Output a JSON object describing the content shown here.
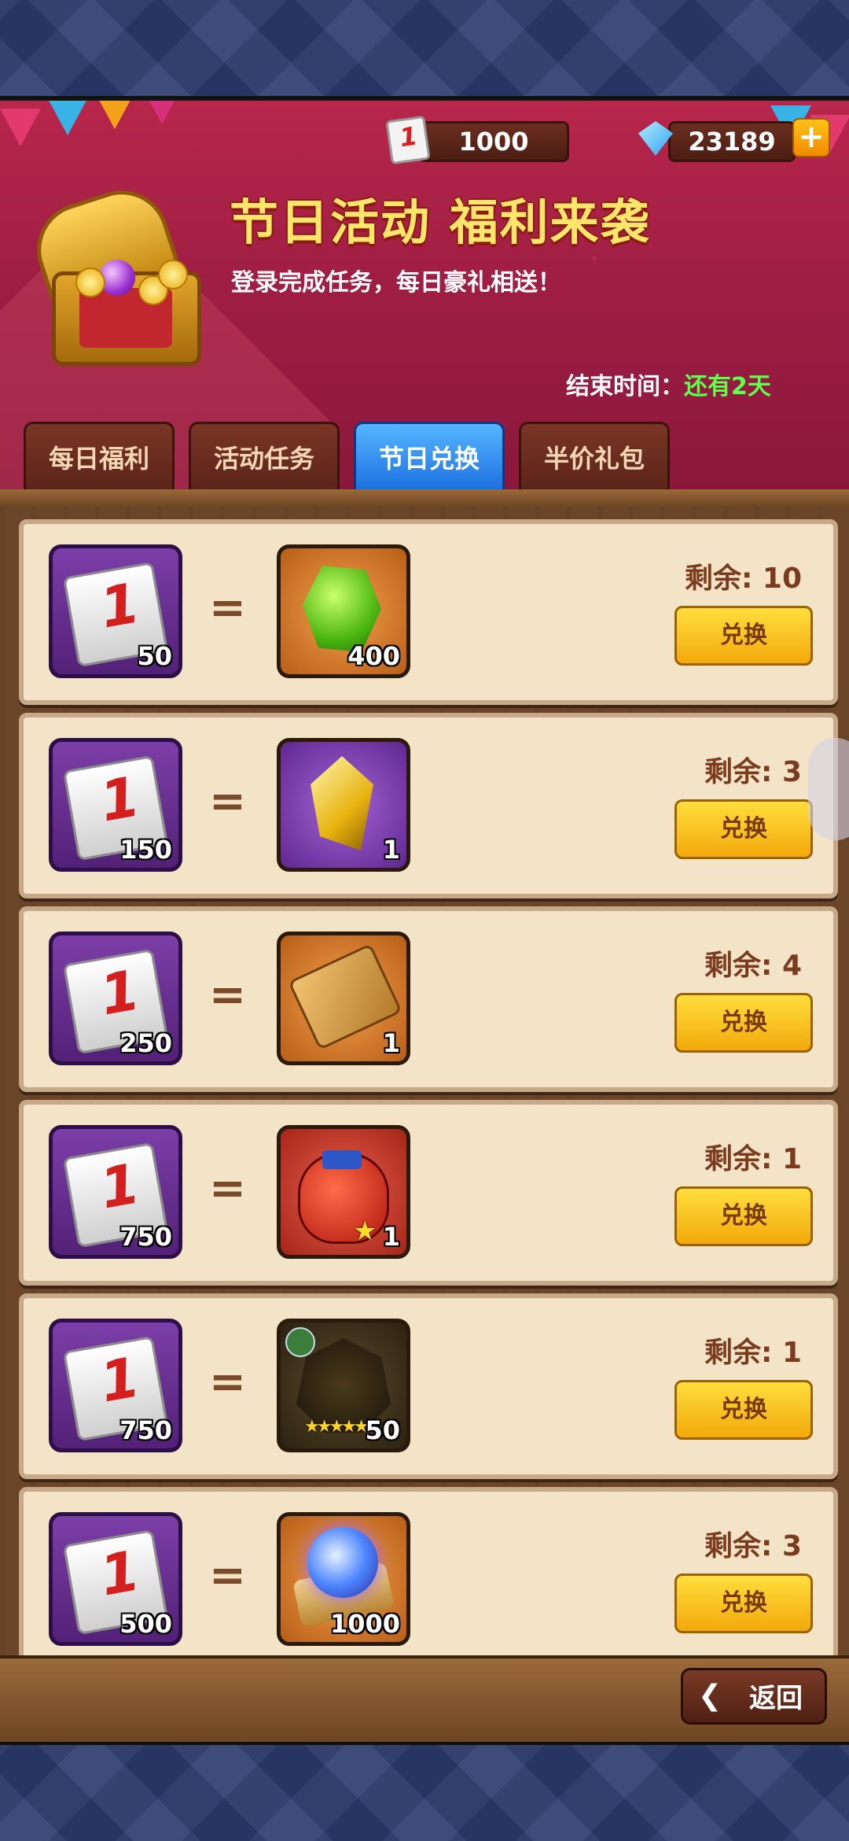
{
  "currency": {
    "tickets": "1000",
    "diamonds": "23189",
    "plus": "+"
  },
  "header": {
    "title": "节日活动 福利来袭",
    "subtitle": "登录完成任务，每日豪礼相送！",
    "end_label": "结束时间：",
    "end_value": "还有2天"
  },
  "tabs": [
    {
      "label": "每日福利"
    },
    {
      "label": "活动任务"
    },
    {
      "label": "节日兑换"
    },
    {
      "label": "半价礼包"
    }
  ],
  "active_tab": "节日兑换",
  "items": [
    {
      "cost": "50",
      "reward_qty": "400",
      "remaining": "剩余: 10",
      "button": "兑换",
      "reward_icon": "green-gem"
    },
    {
      "cost": "150",
      "reward_qty": "1",
      "remaining": "剩余: 3",
      "button": "兑换",
      "reward_icon": "gold-crystal"
    },
    {
      "cost": "250",
      "reward_qty": "1",
      "remaining": "剩余: 4",
      "button": "兑换",
      "reward_icon": "golden-scroll"
    },
    {
      "cost": "750",
      "reward_qty": "1",
      "remaining": "剩余: 1",
      "button": "兑换",
      "reward_icon": "red-bag"
    },
    {
      "cost": "750",
      "reward_qty": "50",
      "remaining": "剩余: 1",
      "button": "兑换",
      "reward_icon": "hero-shard"
    },
    {
      "cost": "500",
      "reward_qty": "1000",
      "remaining": "剩余: 3",
      "button": "兑换",
      "reward_icon": "orb-scroll"
    }
  ],
  "equals": "=",
  "back": {
    "label": "返回"
  }
}
